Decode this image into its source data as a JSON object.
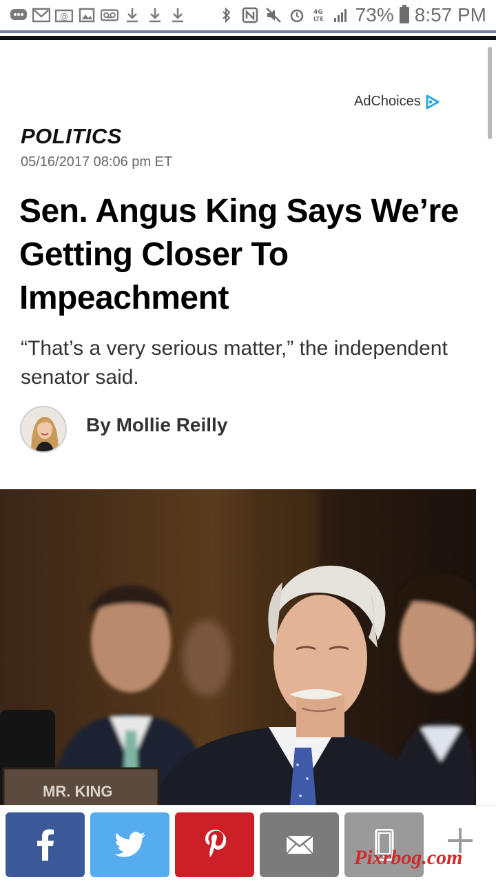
{
  "status_bar": {
    "battery_percent": "73%",
    "time": "8:57 PM",
    "network_label": "4G LTE"
  },
  "ad": {
    "label": "AdChoices"
  },
  "article": {
    "section": "POLITICS",
    "date": "05/16/2017 08:06 pm ET",
    "headline": "Sen. Angus King Says We’re Getting Closer To Impeachment",
    "subhead": "“That’s a very serious matter,” the independent senator said.",
    "byline": "By Mollie Reilly",
    "photo": {
      "nameplate": "MR. KING"
    }
  },
  "share_bar": {
    "buttons": [
      {
        "name": "facebook",
        "icon": "facebook-icon",
        "color": "#3b5998"
      },
      {
        "name": "twitter",
        "icon": "twitter-icon",
        "color": "#55acee"
      },
      {
        "name": "pinterest",
        "icon": "pinterest-icon",
        "color": "#cb2027"
      },
      {
        "name": "email",
        "icon": "envelope-icon",
        "color": "#7b7b7b"
      },
      {
        "name": "sms",
        "icon": "phone-icon",
        "color": "#9a9a9a"
      }
    ],
    "more_icon": "plus-icon"
  },
  "watermark": "Pixrbog.com"
}
